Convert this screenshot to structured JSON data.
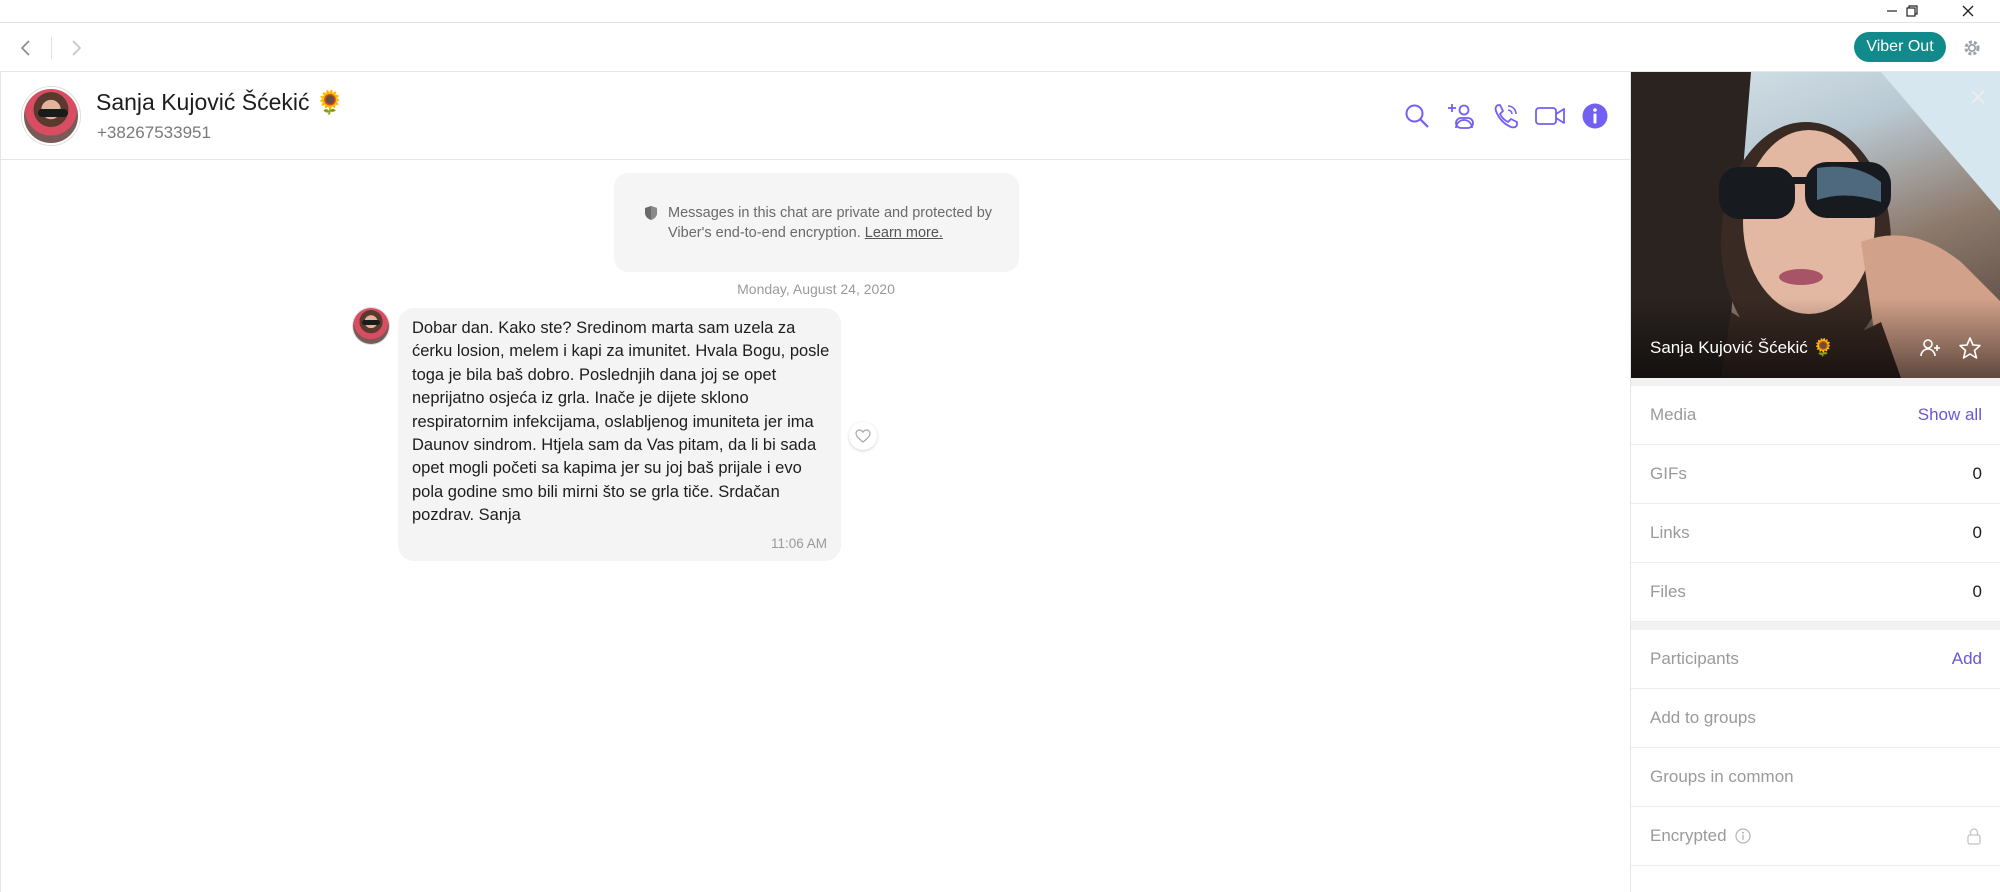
{
  "window": {
    "minimize_icon": "minimize-icon",
    "maximize_icon": "restore-icon",
    "close_icon": "close-icon"
  },
  "nav": {
    "back_icon": "chevron-left-icon",
    "forward_icon": "chevron-right-icon",
    "viber_out_label": "Viber Out",
    "settings_icon": "gear-icon",
    "accent_color": "#118a8c"
  },
  "chat_header": {
    "name": "Sanja Kujović Šćekić 🌻",
    "phone": "+38267533951",
    "icons": [
      "search-icon",
      "add-participant-icon",
      "call-icon",
      "video-call-icon",
      "info-icon"
    ],
    "icon_color": "#7360f2"
  },
  "messages": {
    "encryption_notice": "Messages in this chat are private and protected by Viber's end-to-end encryption.",
    "encryption_link": "Learn more.",
    "date_separator": "Monday, August 24, 2020",
    "items": [
      {
        "text": "Dobar dan. Kako ste? Sredinom marta sam uzela za ćerku losion, melem i kapi za imunitet. Hvala Bogu, posle toga je bila baš dobro. Poslednjih dana joj se opet neprijatno osjeća iz grla. Inače je dijete sklono respiratornim infekcijama, oslabljenog imuniteta jer ima Daunov sindrom. Htjela sam da Vas pitam, da li bi sada opet mogli početi sa kapima jer su joj baš prijale i evo pola godine smo bili mirni što se grla tiče. Srdačan pozdrav. Sanja",
        "time": "11:06 AM"
      }
    ]
  },
  "info_panel": {
    "photo_name": "Sanja Kujović Šćekić 🌻",
    "media_label": "Media",
    "media_action": "Show all",
    "gifs_label": "GIFs",
    "gifs_count": "0",
    "links_label": "Links",
    "links_count": "0",
    "files_label": "Files",
    "files_count": "0",
    "participants_label": "Participants",
    "participants_action": "Add",
    "add_to_groups_label": "Add to groups",
    "groups_in_common_label": "Groups in common",
    "encrypted_label": "Encrypted",
    "link_color": "#6d55d8"
  }
}
